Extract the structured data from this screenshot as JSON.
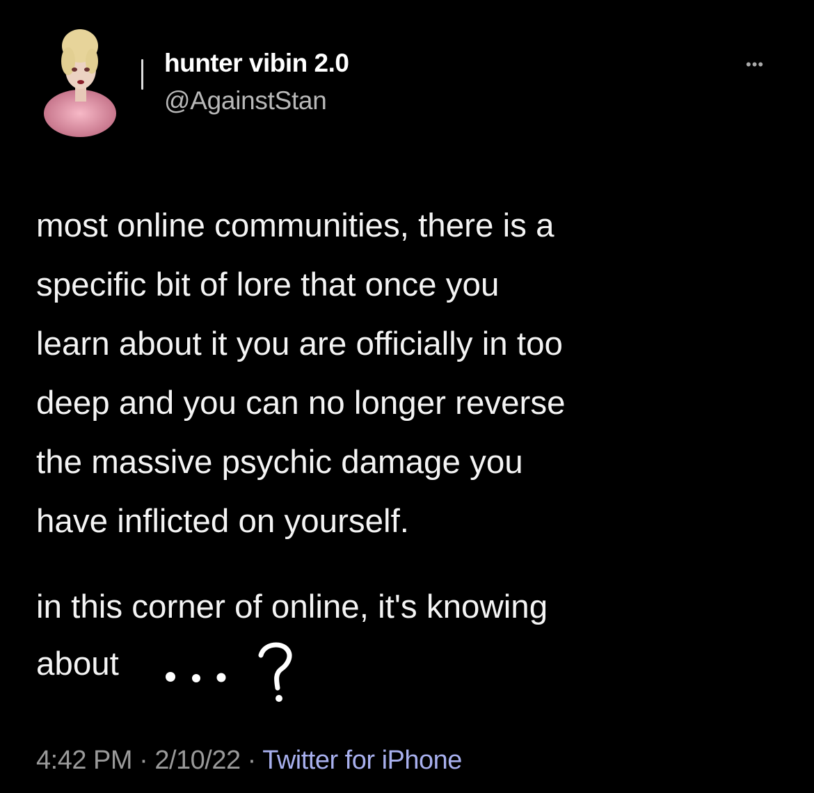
{
  "tweet": {
    "display_name": "hunter vibin 2.0",
    "handle": "@AgainstStan",
    "more_icon": "more-horizontal-icon",
    "body_lines": [
      "most online communities, there is a",
      "specific bit of lore that once you",
      "learn about it you are officially in too",
      "deep and you can no longer reverse",
      "the massive psychic damage you",
      "have inflicted on yourself."
    ],
    "paragraph2_lines": [
      "in this corner of online, it's knowing",
      "about"
    ],
    "handwritten_annotation": "...?",
    "time": "4:42 PM",
    "separator": "·",
    "date": "2/10/22",
    "source": "Twitter for iPhone",
    "colors": {
      "background": "#000000",
      "source_link": "#a8b0ee",
      "meta_text": "#9a9a9a"
    }
  }
}
